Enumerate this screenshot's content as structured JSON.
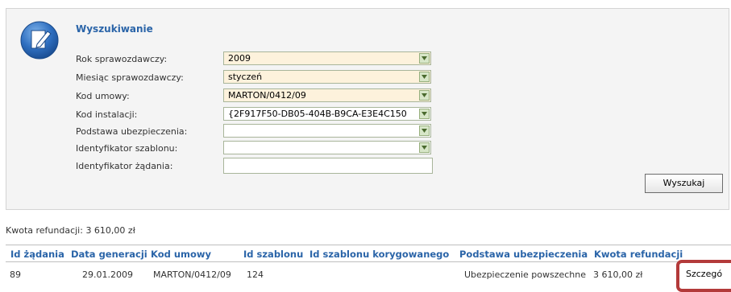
{
  "search": {
    "title": "Wyszukiwanie",
    "fields": [
      {
        "label": "Rok sprawozdawczy:",
        "value": "2009"
      },
      {
        "label": "Miesiąc sprawozdawczy:",
        "value": "styczeń"
      },
      {
        "label": "Kod umowy:",
        "value": "MARTON/0412/09"
      },
      {
        "label": "Kod instalacji:",
        "value": "{2F917F50-DB05-404B-B9CA-E3E4C150"
      },
      {
        "label": "Podstawa ubezpieczenia:",
        "value": ""
      },
      {
        "label": "Identyfikator szablonu:",
        "value": ""
      },
      {
        "label": "Identyfikator żądania:",
        "value": ""
      }
    ],
    "button": "Wyszukaj"
  },
  "summary": "Kwota refundacji: 3 610,00 zł",
  "table": {
    "headers": [
      "Id żądania",
      "Data generacji",
      "Kod umowy",
      "Id szablonu",
      "Id szablonu korygowanego",
      "Podstawa ubezpieczenia",
      "Kwota refundacji"
    ],
    "rows": [
      {
        "id": "89",
        "date": "29.01.2009",
        "contract": "MARTON/0412/09",
        "template": "124",
        "corrected": "",
        "basis": "Ubezpieczenie powszechne",
        "amount": "3 610,00 zł",
        "action": "Szczegó"
      }
    ]
  },
  "colors": {
    "accent": "#2a64a8",
    "required_bg": "#fdf2dc",
    "highlight": "#b33a3a"
  }
}
